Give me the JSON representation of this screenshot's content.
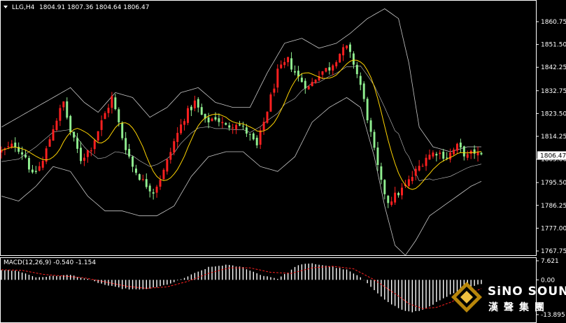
{
  "chart_header": {
    "symbol": "LLG,H4",
    "ohlc": "1804.91 1807.36 1804.64 1806.47"
  },
  "macd_header": "MACD(12,26,9) -0.540 -1.154",
  "logo": {
    "main": "SiNO SOUND",
    "sub": "漢聲集團"
  },
  "colors": {
    "background": "#000000",
    "bull": "#ff2020",
    "bear": "#90ee90",
    "ma": "#ffd400",
    "bands": "#c8c8c8",
    "macd_hist": "#ffffff",
    "macd_signal": "#ff2020",
    "current_price_box": "#ffffff"
  },
  "chart_data": [
    {
      "type": "candlestick",
      "indicator": "Bollinger Bands + moving average",
      "y_ticks": [
        "1860.75",
        "1851.50",
        "1842.25",
        "1832.75",
        "1823.50",
        "1814.25",
        "1805.00",
        "1795.50",
        "1786.25",
        "1777.00",
        "1767.75"
      ],
      "ylim": [
        1766,
        1866
      ],
      "current_price": "1806.47",
      "close_path": [
        [
          0,
          1808
        ],
        [
          4,
          1811
        ],
        [
          7,
          1806
        ],
        [
          9,
          1798
        ],
        [
          12,
          1804
        ],
        [
          15,
          1818
        ],
        [
          18,
          1828
        ],
        [
          20,
          1816
        ],
        [
          23,
          1805
        ],
        [
          26,
          1810
        ],
        [
          29,
          1820
        ],
        [
          32,
          1830
        ],
        [
          35,
          1814
        ],
        [
          38,
          1802
        ],
        [
          41,
          1796
        ],
        [
          44,
          1792
        ],
        [
          47,
          1800
        ],
        [
          50,
          1812
        ],
        [
          53,
          1822
        ],
        [
          56,
          1828
        ],
        [
          59,
          1820
        ],
        [
          62,
          1822
        ],
        [
          65,
          1818
        ],
        [
          68,
          1820
        ],
        [
          71,
          1816
        ],
        [
          74,
          1810
        ],
        [
          77,
          1825
        ],
        [
          80,
          1840
        ],
        [
          83,
          1845
        ],
        [
          86,
          1838
        ],
        [
          89,
          1834
        ],
        [
          92,
          1840
        ],
        [
          95,
          1842
        ],
        [
          98,
          1848
        ],
        [
          100,
          1850
        ],
        [
          102,
          1844
        ],
        [
          104,
          1835
        ],
        [
          106,
          1822
        ],
        [
          108,
          1808
        ],
        [
          110,
          1795
        ],
        [
          112,
          1788
        ],
        [
          114,
          1790
        ],
        [
          117,
          1794
        ],
        [
          120,
          1800
        ],
        [
          123,
          1806
        ],
        [
          126,
          1808
        ],
        [
          129,
          1806
        ],
        [
          132,
          1810
        ],
        [
          135,
          1806
        ],
        [
          137,
          1808
        ],
        [
          139,
          1806
        ]
      ],
      "upper_band_path": [
        [
          0,
          1818
        ],
        [
          5,
          1822
        ],
        [
          10,
          1826
        ],
        [
          15,
          1830
        ],
        [
          20,
          1834
        ],
        [
          24,
          1828
        ],
        [
          28,
          1824
        ],
        [
          33,
          1832
        ],
        [
          38,
          1830
        ],
        [
          43,
          1822
        ],
        [
          48,
          1826
        ],
        [
          52,
          1832
        ],
        [
          57,
          1834
        ],
        [
          62,
          1828
        ],
        [
          67,
          1826
        ],
        [
          72,
          1826
        ],
        [
          77,
          1840
        ],
        [
          82,
          1852
        ],
        [
          87,
          1854
        ],
        [
          92,
          1850
        ],
        [
          97,
          1852
        ],
        [
          101,
          1856
        ],
        [
          106,
          1862
        ],
        [
          111,
          1866
        ],
        [
          115,
          1862
        ],
        [
          118,
          1844
        ],
        [
          121,
          1818
        ],
        [
          125,
          1810
        ],
        [
          130,
          1808
        ],
        [
          135,
          1810
        ],
        [
          139,
          1810
        ]
      ],
      "lower_band_path": [
        [
          0,
          1790
        ],
        [
          5,
          1788
        ],
        [
          10,
          1794
        ],
        [
          15,
          1802
        ],
        [
          20,
          1800
        ],
        [
          25,
          1790
        ],
        [
          30,
          1784
        ],
        [
          35,
          1784
        ],
        [
          40,
          1782
        ],
        [
          45,
          1782
        ],
        [
          50,
          1786
        ],
        [
          55,
          1798
        ],
        [
          60,
          1806
        ],
        [
          65,
          1808
        ],
        [
          70,
          1808
        ],
        [
          75,
          1802
        ],
        [
          80,
          1800
        ],
        [
          85,
          1806
        ],
        [
          90,
          1820
        ],
        [
          95,
          1826
        ],
        [
          100,
          1830
        ],
        [
          104,
          1826
        ],
        [
          108,
          1806
        ],
        [
          111,
          1786
        ],
        [
          114,
          1770
        ],
        [
          117,
          1766
        ],
        [
          120,
          1772
        ],
        [
          124,
          1782
        ],
        [
          128,
          1786
        ],
        [
          132,
          1790
        ],
        [
          136,
          1794
        ],
        [
          139,
          1796
        ]
      ]
    },
    {
      "type": "macd",
      "y_ticks": [
        "7.621",
        "0.00",
        "-13.895"
      ],
      "ylim": [
        -13.895,
        7.621
      ],
      "histogram_path": [
        [
          0,
          4
        ],
        [
          5,
          3.5
        ],
        [
          10,
          1
        ],
        [
          15,
          1.5
        ],
        [
          20,
          2
        ],
        [
          25,
          0.2
        ],
        [
          30,
          -2
        ],
        [
          35,
          -3.5
        ],
        [
          40,
          -4
        ],
        [
          45,
          -3
        ],
        [
          50,
          -1
        ],
        [
          55,
          2
        ],
        [
          60,
          5
        ],
        [
          65,
          6
        ],
        [
          70,
          5
        ],
        [
          75,
          2
        ],
        [
          80,
          0.5
        ],
        [
          83,
          3
        ],
        [
          86,
          6
        ],
        [
          90,
          6.5
        ],
        [
          95,
          5.5
        ],
        [
          100,
          4
        ],
        [
          104,
          1
        ],
        [
          108,
          -4
        ],
        [
          112,
          -9
        ],
        [
          116,
          -12
        ],
        [
          119,
          -13
        ],
        [
          122,
          -12
        ],
        [
          126,
          -9
        ],
        [
          130,
          -6
        ],
        [
          134,
          -4
        ],
        [
          138,
          -2
        ],
        [
          139,
          -1.5
        ]
      ],
      "signal_path": [
        [
          0,
          4
        ],
        [
          6,
          3.8
        ],
        [
          12,
          2.2
        ],
        [
          18,
          1.5
        ],
        [
          24,
          0.8
        ],
        [
          30,
          -0.8
        ],
        [
          36,
          -2.5
        ],
        [
          42,
          -3.4
        ],
        [
          48,
          -2.8
        ],
        [
          54,
          -0.6
        ],
        [
          60,
          2.6
        ],
        [
          66,
          4.8
        ],
        [
          72,
          4.8
        ],
        [
          78,
          3
        ],
        [
          84,
          2.6
        ],
        [
          90,
          4.8
        ],
        [
          96,
          5.4
        ],
        [
          102,
          4.4
        ],
        [
          108,
          0
        ],
        [
          114,
          -5.5
        ],
        [
          118,
          -9.5
        ],
        [
          122,
          -11.5
        ],
        [
          126,
          -11
        ],
        [
          130,
          -9
        ],
        [
          134,
          -6.5
        ],
        [
          139,
          -3.5
        ]
      ]
    }
  ]
}
